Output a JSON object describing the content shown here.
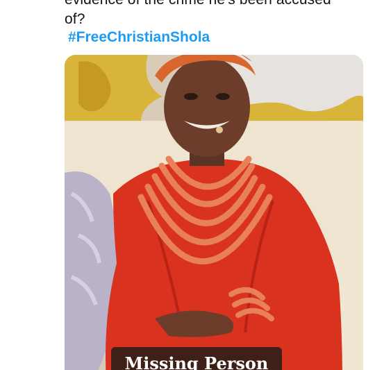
{
  "tweet": {
    "text_line1": "evidence of the crime he's been accused",
    "text_line2": "of?",
    "hashtag": "#FreeChristianShola"
  },
  "media": {
    "overlay_label": "Missing Person"
  },
  "colors": {
    "text": "#0f1419",
    "link": "#1d9bf0",
    "dress": "#d9321f",
    "coral_beads": "#e8805a"
  }
}
